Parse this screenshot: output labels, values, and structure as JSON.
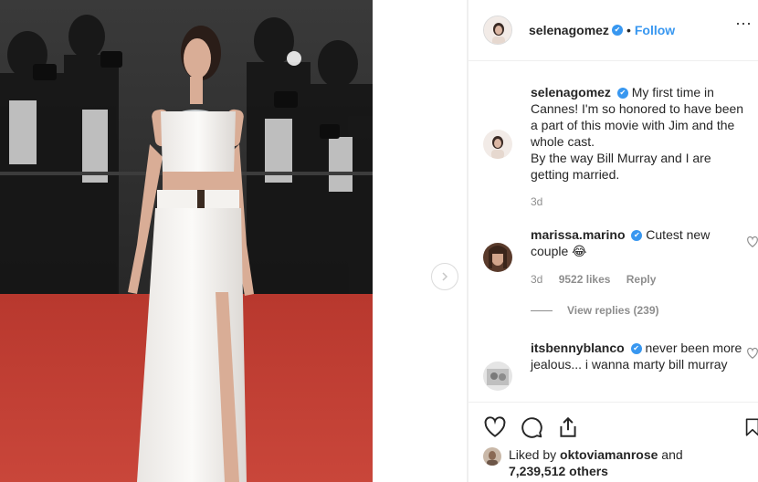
{
  "post": {
    "author": "selenagomez",
    "follow_label": "Follow",
    "dot": "•",
    "more": "···"
  },
  "caption": {
    "user": "selenagomez",
    "text": "My first time in Cannes! I'm so honored to have been a part of this movie with Jim and the whole cast.",
    "text2": "By the way Bill Murray and I are getting married.",
    "time": "3d"
  },
  "comments": [
    {
      "user": "marissa.marino",
      "text": "Cutest new couple 😂",
      "time": "3d",
      "likes": "9522 likes",
      "reply": "Reply",
      "view_replies": "View replies (239)"
    },
    {
      "user": "itsbennyblanco",
      "text": "never been more jealous... i wanna marty bill murray"
    }
  ],
  "liked_by": {
    "prefix": "Liked by ",
    "user": "oktoviamanrose",
    "suffix": " and",
    "others": "7,239,512 others"
  },
  "icons": {
    "verified": "✔"
  },
  "colors": {
    "accent": "#3897f0",
    "carpet": "#c0392b",
    "meta": "#8e8e8e"
  }
}
